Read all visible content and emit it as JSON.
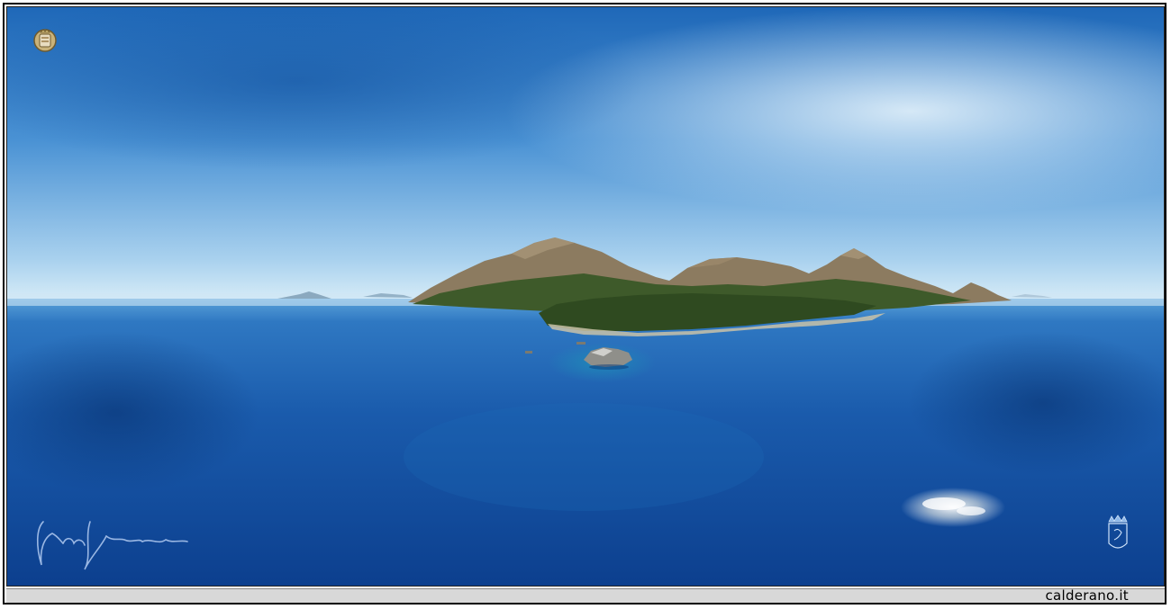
{
  "footer": {
    "site_label": "calderano.it"
  },
  "icons": {
    "top_left": "coat-of-arms-icon",
    "bottom_right": "crowned-crest-icon",
    "bottom_left": "signature"
  },
  "colors": {
    "sky_top": "#1f6fc0",
    "sky_horizon": "#d8ecf7",
    "sea_deep": "#1050a0",
    "sea_near": "#0a3a85",
    "land_green": "#3f5a2a",
    "mountain_brown": "#8a7a62"
  }
}
